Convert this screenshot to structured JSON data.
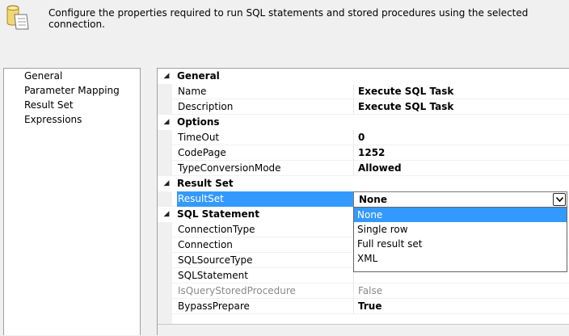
{
  "header": {
    "description": "Configure the properties required to run SQL statements and stored procedures using the selected connection.",
    "icon": "sql-task-icon"
  },
  "nav": {
    "items": [
      {
        "label": "General"
      },
      {
        "label": "Parameter Mapping"
      },
      {
        "label": "Result Set"
      },
      {
        "label": "Expressions"
      }
    ]
  },
  "grid": {
    "categories": {
      "general": {
        "label": "General",
        "toggle": "◢"
      },
      "options": {
        "label": "Options",
        "toggle": "◢"
      },
      "result_set": {
        "label": "Result Set",
        "toggle": "◢"
      },
      "sql_statement": {
        "label": "SQL Statement",
        "toggle": "◢"
      }
    },
    "properties": {
      "name": {
        "label": "Name",
        "value": "Execute SQL Task"
      },
      "description": {
        "label": "Description",
        "value": "Execute SQL Task"
      },
      "timeout": {
        "label": "TimeOut",
        "value": "0"
      },
      "codepage": {
        "label": "CodePage",
        "value": "1252"
      },
      "type_conversion_mode": {
        "label": "TypeConversionMode",
        "value": "Allowed"
      },
      "result_set": {
        "label": "ResultSet",
        "value": "None"
      },
      "connection_type": {
        "label": "ConnectionType",
        "value": ""
      },
      "connection": {
        "label": "Connection",
        "value": ""
      },
      "sql_source_type": {
        "label": "SQLSourceType",
        "value": ""
      },
      "sql_statement": {
        "label": "SQLStatement",
        "value": ""
      },
      "is_query_stored_procedure": {
        "label": "IsQueryStoredProcedure",
        "value": "False"
      },
      "bypass_prepare": {
        "label": "BypassPrepare",
        "value": "True"
      }
    },
    "dropdown": {
      "options": [
        "None",
        "Single row",
        "Full result set",
        "XML"
      ],
      "selected": "None"
    }
  },
  "colors": {
    "selection": "#3399ff",
    "window_bg": "#f0f0f0",
    "readonly_text": "#8a8a8a"
  }
}
